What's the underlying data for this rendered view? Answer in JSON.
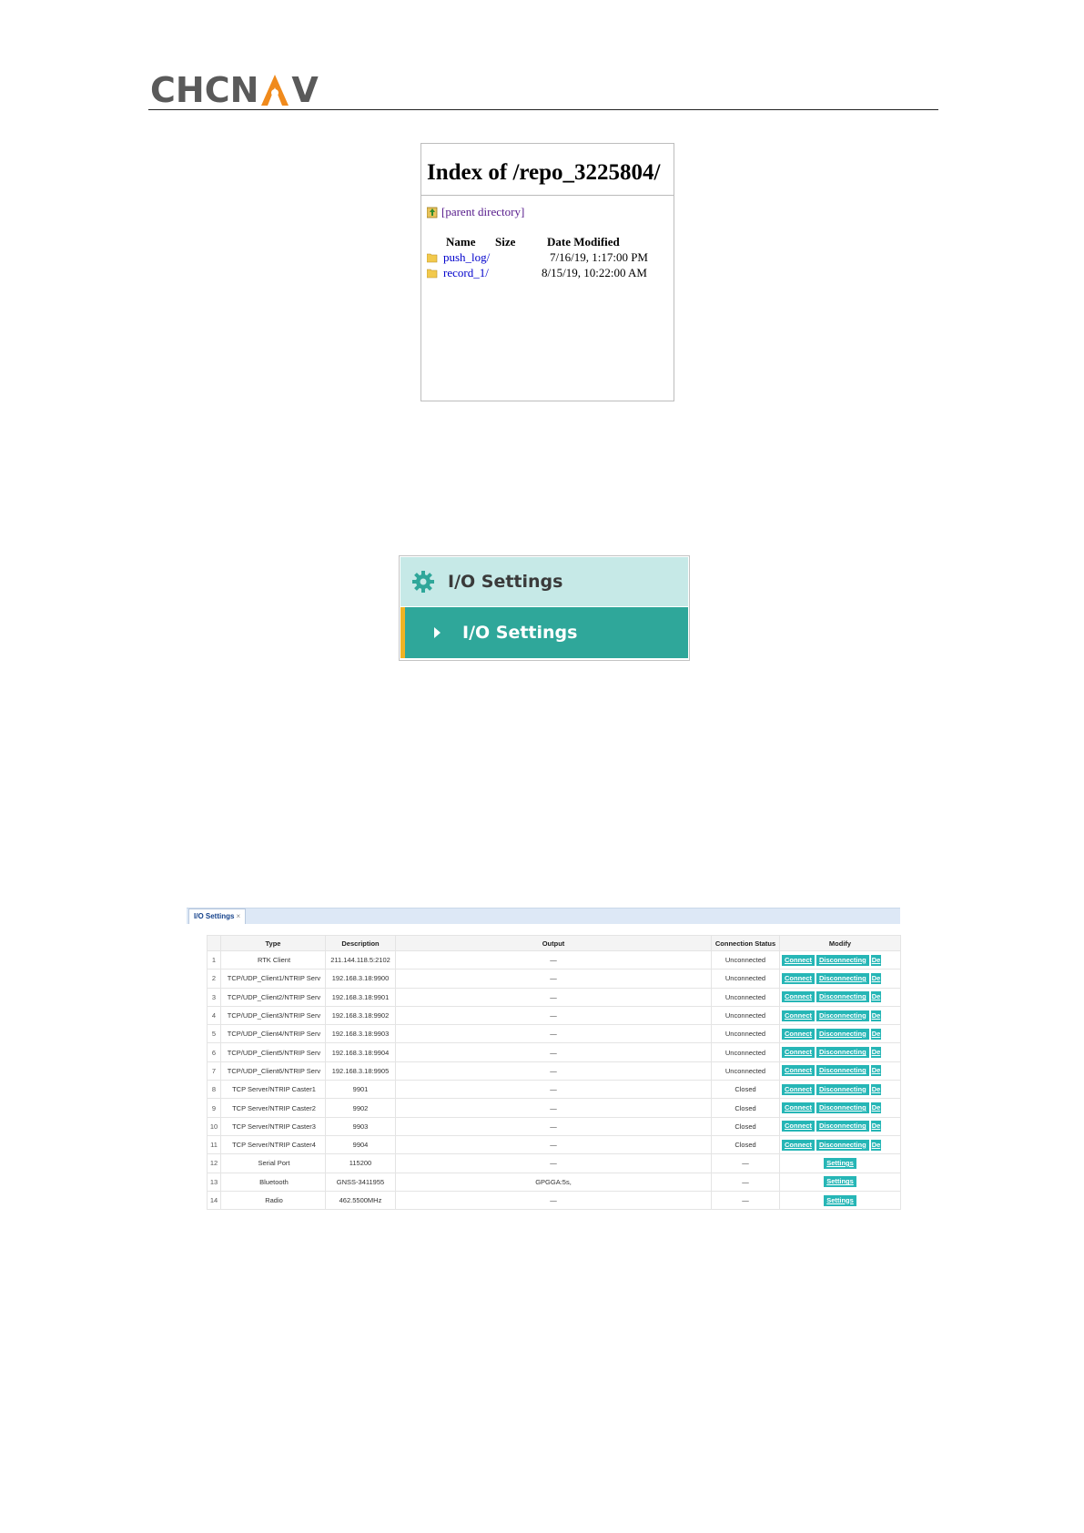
{
  "header": {
    "logo_left": "CHCN",
    "logo_right": "V",
    "logo_accent": "#f08a1c",
    "logo_color": "#5a5a5a"
  },
  "directory": {
    "title": "Index of /repo_3225804/",
    "parent_link": "[parent directory]",
    "columns": {
      "name": "Name",
      "size": "Size",
      "date": "Date Modified"
    },
    "entries": [
      {
        "name": "push_log/",
        "date": "7/16/19, 1:17:00 PM"
      },
      {
        "name": "record_1/",
        "date": "8/15/19, 10:22:00 AM"
      }
    ]
  },
  "menu": {
    "top_label": "I/O Settings",
    "sub_label": "I/O Settings",
    "top_icon": "gear-icon",
    "sub_icon": "triangle-right-icon",
    "colors": {
      "top_bg": "#c6e9e7",
      "sub_bg": "#2fa79a",
      "accent": "#f0b323"
    }
  },
  "io_settings": {
    "tab_label": "I/O Settings",
    "tab_close": "×",
    "columns": [
      "",
      "Type",
      "Description",
      "Output",
      "Connection Status",
      "Modify"
    ],
    "buttons": {
      "connect": "Connect",
      "disconnect": "Disconnecting",
      "truncated": "De",
      "settings": "Settings"
    },
    "rows": [
      {
        "num": "1",
        "type": "RTK Client",
        "description": "211.144.118.5:2102",
        "output": "—",
        "status": "Unconnected",
        "modify": "connect"
      },
      {
        "num": "2",
        "type": "TCP/UDP_Client1/NTRIP Serv",
        "description": "192.168.3.18:9900",
        "output": "—",
        "status": "Unconnected",
        "modify": "connect"
      },
      {
        "num": "3",
        "type": "TCP/UDP_Client2/NTRIP Serv",
        "description": "192.168.3.18:9901",
        "output": "—",
        "status": "Unconnected",
        "modify": "connect"
      },
      {
        "num": "4",
        "type": "TCP/UDP_Client3/NTRIP Serv",
        "description": "192.168.3.18:9902",
        "output": "—",
        "status": "Unconnected",
        "modify": "connect"
      },
      {
        "num": "5",
        "type": "TCP/UDP_Client4/NTRIP Serv",
        "description": "192.168.3.18:9903",
        "output": "—",
        "status": "Unconnected",
        "modify": "connect"
      },
      {
        "num": "6",
        "type": "TCP/UDP_Client5/NTRIP Serv",
        "description": "192.168.3.18:9904",
        "output": "—",
        "status": "Unconnected",
        "modify": "connect"
      },
      {
        "num": "7",
        "type": "TCP/UDP_Client6/NTRIP Serv",
        "description": "192.168.3.18:9905",
        "output": "—",
        "status": "Unconnected",
        "modify": "connect"
      },
      {
        "num": "8",
        "type": "TCP Server/NTRIP Caster1",
        "description": "9901",
        "output": "—",
        "status": "Closed",
        "modify": "connect"
      },
      {
        "num": "9",
        "type": "TCP Server/NTRIP Caster2",
        "description": "9902",
        "output": "—",
        "status": "Closed",
        "modify": "connect"
      },
      {
        "num": "10",
        "type": "TCP Server/NTRIP Caster3",
        "description": "9903",
        "output": "—",
        "status": "Closed",
        "modify": "connect"
      },
      {
        "num": "11",
        "type": "TCP Server/NTRIP Caster4",
        "description": "9904",
        "output": "—",
        "status": "Closed",
        "modify": "connect"
      },
      {
        "num": "12",
        "type": "Serial Port",
        "description": "115200",
        "output": "—",
        "status": "—",
        "modify": "settings"
      },
      {
        "num": "13",
        "type": "Bluetooth",
        "description": "GNSS-3411955",
        "output": "GPGGA:5s,",
        "status": "—",
        "modify": "settings"
      },
      {
        "num": "14",
        "type": "Radio",
        "description": "462.5500MHz",
        "output": "—",
        "status": "—",
        "modify": "settings"
      }
    ]
  }
}
